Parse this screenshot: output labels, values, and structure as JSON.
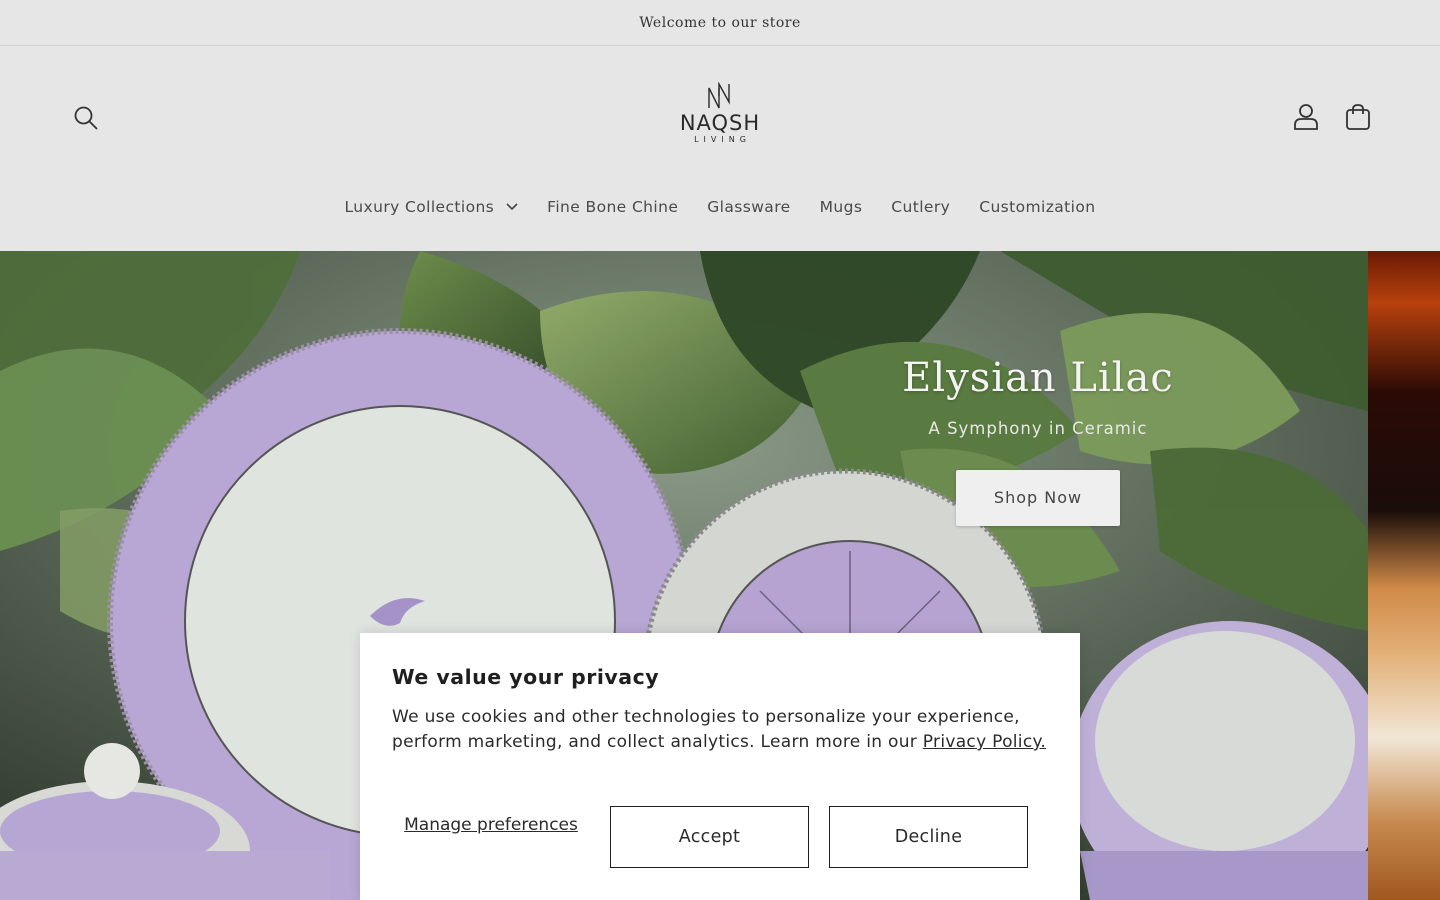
{
  "announcement": {
    "text": "Welcome to our store"
  },
  "header": {
    "logo_text": "NAQSH",
    "logo_subtext": "LIVING",
    "icons": {
      "search": "search-icon",
      "account": "user-icon",
      "cart": "shopping-bag-icon"
    }
  },
  "nav": {
    "items": [
      {
        "label": "Luxury Collections",
        "has_dropdown": true
      },
      {
        "label": "Fine Bone Chine"
      },
      {
        "label": "Glassware"
      },
      {
        "label": "Mugs"
      },
      {
        "label": "Cutlery"
      },
      {
        "label": "Customization"
      }
    ]
  },
  "hero": {
    "title": "Elysian Lilac",
    "subtitle": "A Symphony in Ceramic",
    "button_label": "Shop Now"
  },
  "cookie": {
    "title": "We value your privacy",
    "text": "We use cookies and other technologies to personalize your experience, perform marketing, and collect analytics. Learn more in our ",
    "link_text": "Privacy Policy.",
    "manage_label": "Manage preferences",
    "accept_label": "Accept",
    "decline_label": "Decline"
  },
  "colors": {
    "background": "#e6e6e6",
    "text": "#3b3b3b",
    "hero_lilac": "#b9a6d6",
    "button_bg": "#efefef"
  }
}
